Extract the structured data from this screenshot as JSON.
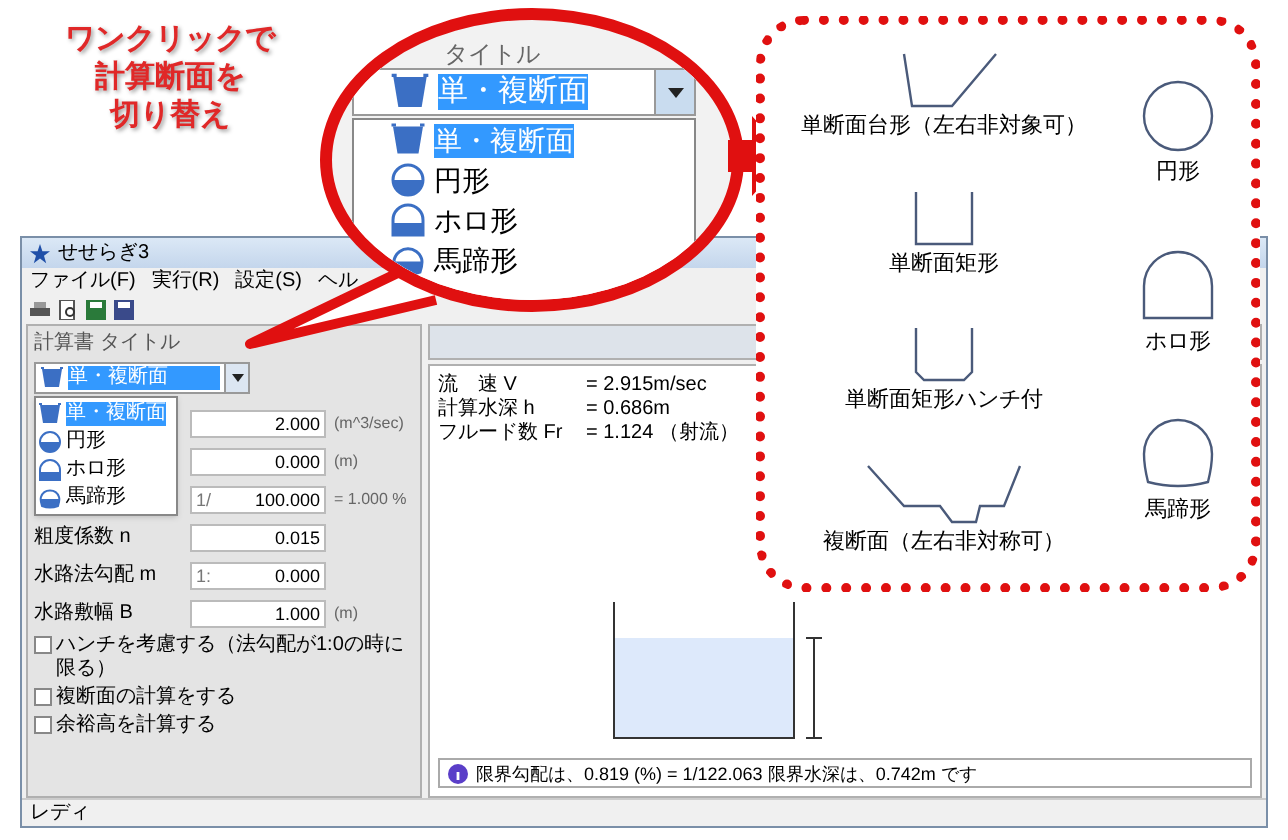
{
  "annotation": {
    "lines": [
      "ワンクリックで",
      "計算断面を",
      "切り替え"
    ]
  },
  "app": {
    "title": "せせらぎ3",
    "menu": [
      "ファイル(F)",
      "実行(R)",
      "設定(S)",
      "ヘル"
    ],
    "title_label": "計算書 タイトル",
    "section_dropdown": {
      "value": "単・複断面",
      "kind": "trapezoid",
      "options": [
        {
          "label": "単・複断面",
          "kind": "trapezoid",
          "selected": true
        },
        {
          "label": "円形",
          "kind": "circle",
          "selected": false
        },
        {
          "label": "ホロ形",
          "kind": "hood",
          "selected": false
        },
        {
          "label": "馬蹄形",
          "kind": "horseshoe",
          "selected": false
        }
      ]
    },
    "form_rows": [
      {
        "value": "2.000",
        "unit": "(m^3/sec)"
      },
      {
        "value": "0.000",
        "unit": "(m)"
      },
      {
        "prefix": "1/",
        "value": "100.000",
        "note": "= 1.000 %"
      },
      {
        "label": "粗度係数 n",
        "value": "0.015"
      },
      {
        "label": "水路法勾配 m",
        "prefix": "1:",
        "value": "0.000"
      },
      {
        "label": "水路敷幅 B",
        "value": "1.000",
        "unit": "(m)"
      }
    ],
    "checkboxes": [
      {
        "label": "ハンチを考慮する（法勾配が1:0の時に限る）",
        "checked": false
      },
      {
        "label": "複断面の計算をする",
        "checked": false
      },
      {
        "label": "余裕高を計算する",
        "checked": false
      }
    ],
    "results": [
      {
        "name": "流　速 V",
        "value": "= 2.915m/sec"
      },
      {
        "name": "計算水深 h",
        "value": "= 0.686m"
      },
      {
        "name": "フルード数 Fr",
        "value": "= 1.124 （射流）"
      }
    ],
    "message": "限界勾配は、0.819 (%) = 1/122.063 限界水深は、0.742m です",
    "status_bar": "レディ"
  },
  "callout": {
    "title_label": "タイトル",
    "dropdown": {
      "value": "単・複断面",
      "kind": "trapezoid",
      "options": [
        {
          "label": "単・複断面",
          "kind": "trapezoid",
          "selected": true
        },
        {
          "label": "円形",
          "kind": "circle",
          "selected": false
        },
        {
          "label": "ホロ形",
          "kind": "hood",
          "selected": false
        },
        {
          "label": "馬蹄形",
          "kind": "horseshoe",
          "selected": false
        }
      ]
    }
  },
  "shapes_panel": {
    "left": [
      {
        "kind": "trapezoid",
        "label": "単断面台形（左右非対象可）"
      },
      {
        "kind": "rectangle",
        "label": "単断面矩形"
      },
      {
        "kind": "haunch",
        "label": "単断面矩形ハンチ付"
      },
      {
        "kind": "compound",
        "label": "複断面（左右非対称可）"
      }
    ],
    "right": [
      {
        "kind": "circle",
        "label": "円形"
      },
      {
        "kind": "hood",
        "label": "ホロ形"
      },
      {
        "kind": "horseshoe",
        "label": "馬蹄形"
      }
    ]
  }
}
